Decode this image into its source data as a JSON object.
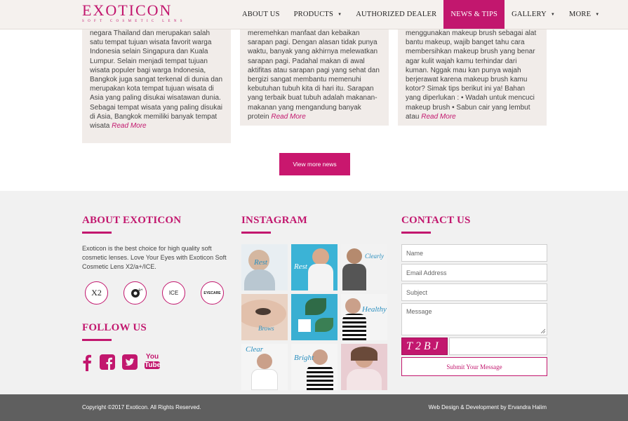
{
  "header": {
    "logo": "EXOTICON",
    "logo_tagline": "SOFT COSMETIC LENS",
    "nav": [
      {
        "label": "ABOUT US",
        "dropdown": false,
        "active": false
      },
      {
        "label": "PRODUCTS",
        "dropdown": true,
        "active": false
      },
      {
        "label": "AUTHORIZED DEALER",
        "dropdown": false,
        "active": false
      },
      {
        "label": "NEWS & TIPS",
        "dropdown": false,
        "active": true
      },
      {
        "label": "GALLERY",
        "dropdown": true,
        "active": false
      },
      {
        "label": "MORE",
        "dropdown": true,
        "active": false
      }
    ]
  },
  "cards": [
    {
      "text": "negara Thailand dan merupakan salah satu tempat tujuan wisata favorit warga Indonesia selain Singapura dan Kuala Lumpur. Selain menjadi tempat tujuan wisata populer bagi warga Indonesia, Bangkok juga sangat terkenal di dunia dan merupakan kota tempat tujuan wisata di Asia yang paling disukai wisatawan dunia. Sebagai tempat wisata yang paling disukai di Asia, Bangkok memiliki banyak tempat wisata",
      "read_more": "Read More"
    },
    {
      "text": "meremehkan manfaat dan kebaikan sarapan pagi. Dengan alasan tidak punya waktu, banyak yang akhirnya  melewatkan sarapan pagi. Padahal makan di awal aktifitas atau sarapan pagi yang sehat dan bergizi sangat membantu memenuhi kebutuhan tubuh kita di hari itu. Sarapan yang terbaik buat tubuh adalah makanan-makanan yang mengandung banyak protein",
      "read_more": "Read More"
    },
    {
      "text": "menggunakan makeup brush sebagai alat bantu makeup, wajib banget tahu cara membersihkan makeup brush yang benar agar kulit wajah kamu terhindar dari kuman. Nggak mau kan punya wajah berjerawat karena makeup brush kamu kotor? Simak tips berikut ini ya!  Bahan yang diperlukan :  •   Wadah untuk mencuci makeup brush • Sabun cair yang lembut atau",
      "read_more": "Read More"
    }
  ],
  "view_more": "View more news",
  "about": {
    "title": "ABOUT EXOTICON",
    "text": "Exoticon is the best choice for high quality soft cosmetic lenses. Love Your Eyes with Exoticon Soft Cosmetic Lens X2/a+/ICE.",
    "badges": [
      "X2",
      "a+",
      "ICE",
      "EYECARE"
    ]
  },
  "follow": {
    "title": "FOLLOW US",
    "icons": [
      "facebook-icon",
      "facebook-square-icon",
      "twitter-icon",
      "youtube-icon"
    ],
    "youtube_top": "You",
    "youtube_bottom": "Tube"
  },
  "instagram": {
    "title": "INSTAGRAM",
    "captions": [
      "Rest",
      "Rest",
      "",
      "Clearly",
      "Brows",
      "",
      "Healthy",
      "Clear",
      "Bright",
      ""
    ]
  },
  "contact": {
    "title": "CONTACT US",
    "name_placeholder": "Name",
    "email_placeholder": "Email Address",
    "subject_placeholder": "Subject",
    "message_placeholder": "Message",
    "captcha": "T2BJ",
    "submit": "Submit Your Message"
  },
  "footer": {
    "copyright": "Copyright ©2017 Exoticon. All Rights Reserved.",
    "credit": "Web Design & Development by Ervandra Halim"
  },
  "colors": {
    "accent": "#c2176e",
    "card_bg": "#f1ece9",
    "footer_bg": "#f1f1f1",
    "bottom_bar": "#5f5f5f"
  }
}
